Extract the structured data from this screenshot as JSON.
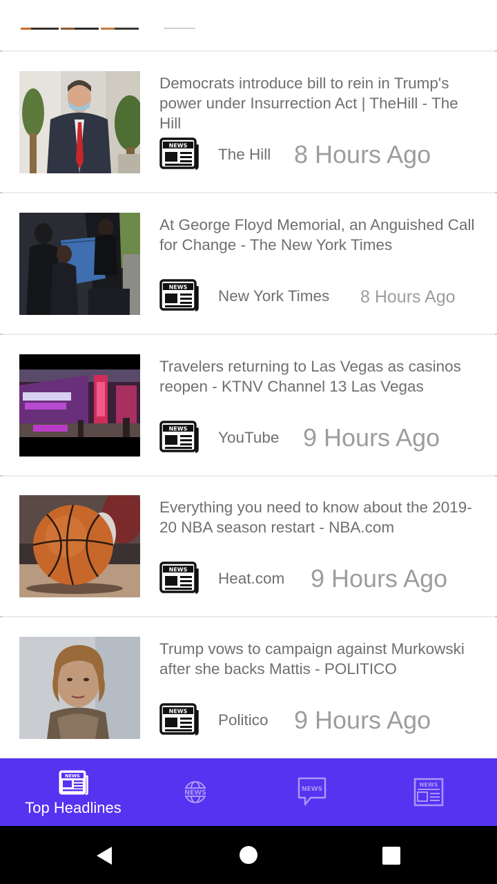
{
  "articles": [
    {
      "headline": "Democrats introduce bill to rein in Trump's power under Insurrection Act | TheHill - The Hill",
      "source": "The Hill",
      "time": "8 Hours Ago",
      "thumbnail": "politician-in-mask-photo",
      "icon": "news-icon"
    },
    {
      "headline": "At George Floyd Memorial, an Anguished Call for Change - The New York Times",
      "source": "New York Times",
      "time": "8 Hours Ago",
      "thumbnail": "casket-bearers-photo",
      "icon": "news-icon"
    },
    {
      "headline": "Travelers returning to Las Vegas as casinos reopen - KTNV Channel 13 Las Vegas",
      "source": "YouTube",
      "time": "9 Hours Ago",
      "thumbnail": "las-vegas-airport-photo",
      "icon": "news-icon"
    },
    {
      "headline": "Everything you need to know about the 2019-20 NBA season restart - NBA.com",
      "source": "Heat.com",
      "time": "9 Hours Ago",
      "thumbnail": "basketball-photo",
      "icon": "news-icon"
    },
    {
      "headline": "Trump vows to campaign against Murkowski after she backs Mattis - POLITICO",
      "source": "Politico",
      "time": "9 Hours Ago",
      "thumbnail": "senator-portrait-photo",
      "icon": "news-icon"
    }
  ],
  "bottom_nav": {
    "tabs": [
      {
        "label": "Top Headlines",
        "icon": "newspaper-icon",
        "selected": true
      },
      {
        "label": "",
        "icon": "globe-news-icon",
        "selected": false
      },
      {
        "label": "",
        "icon": "news-chat-icon",
        "selected": false
      },
      {
        "label": "",
        "icon": "news-page-icon",
        "selected": false
      }
    ]
  },
  "system_nav": {
    "buttons": [
      "back-icon",
      "home-icon",
      "recents-icon"
    ]
  },
  "colors": {
    "nav_background": "#5533f0",
    "headline_text": "#6f6f6f",
    "time_text": "#9d9d9d"
  }
}
